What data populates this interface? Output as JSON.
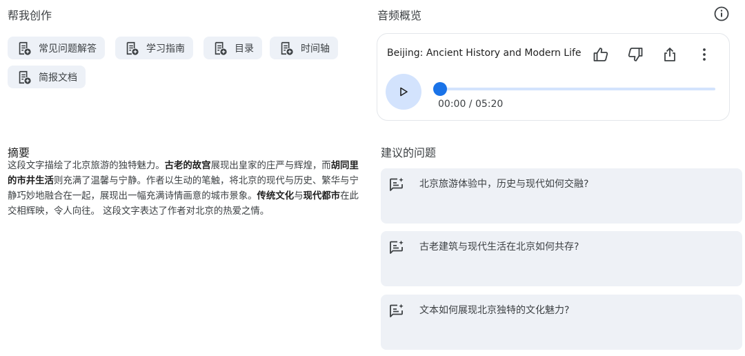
{
  "help_create": {
    "title": "帮我创作",
    "chips": [
      {
        "label": "常见问题解答",
        "icon": "doc-add-icon"
      },
      {
        "label": "学习指南",
        "icon": "doc-add-icon"
      },
      {
        "label": "目录",
        "icon": "doc-add-icon"
      },
      {
        "label": "时间轴",
        "icon": "doc-add-icon"
      },
      {
        "label": "简报文档",
        "icon": "doc-add-icon"
      }
    ]
  },
  "audio": {
    "title": "音频概览",
    "track_title": "Beijing: Ancient History and Modern Life",
    "current_time": "00:00",
    "separator": " / ",
    "duration": "05:20",
    "progress": 0,
    "icons": [
      "thumb-up-icon",
      "thumb-down-icon",
      "share-icon",
      "more-vert-icon",
      "play-icon",
      "info-icon"
    ]
  },
  "summary": {
    "title": "摘要",
    "segments": [
      {
        "text": "这段文字描绘了北京旅游的独特魅力。",
        "bold": false
      },
      {
        "text": "古老的故宫",
        "bold": true
      },
      {
        "text": "展现出皇家的庄严与辉煌，而",
        "bold": false
      },
      {
        "text": "胡同里的市井生活",
        "bold": true
      },
      {
        "text": "则充满了温馨与宁静。作者以生动的笔触，将北京的现代与历史、繁华与宁静巧妙地融合在一起，展现出一幅充满诗情画意的城市景象。",
        "bold": false
      },
      {
        "text": "传统文化",
        "bold": true
      },
      {
        "text": "与",
        "bold": false
      },
      {
        "text": "现代都市",
        "bold": true
      },
      {
        "text": "在此交相辉映，令人向往。 这段文字表达了作者对北京的热爱之情。",
        "bold": false
      }
    ]
  },
  "questions": {
    "title": "建议的问题",
    "items": [
      {
        "text": "北京旅游体验中，历史与现代如何交融?"
      },
      {
        "text": "古老建筑与现代生活在北京如何共存?"
      },
      {
        "text": "文本如何展现北京独特的文化魅力?"
      }
    ]
  },
  "colors": {
    "accent": "#1a73e8",
    "chip_bg": "#edf1f7",
    "card_bg": "#eef1f6",
    "play_bg": "#d3e3fd"
  }
}
